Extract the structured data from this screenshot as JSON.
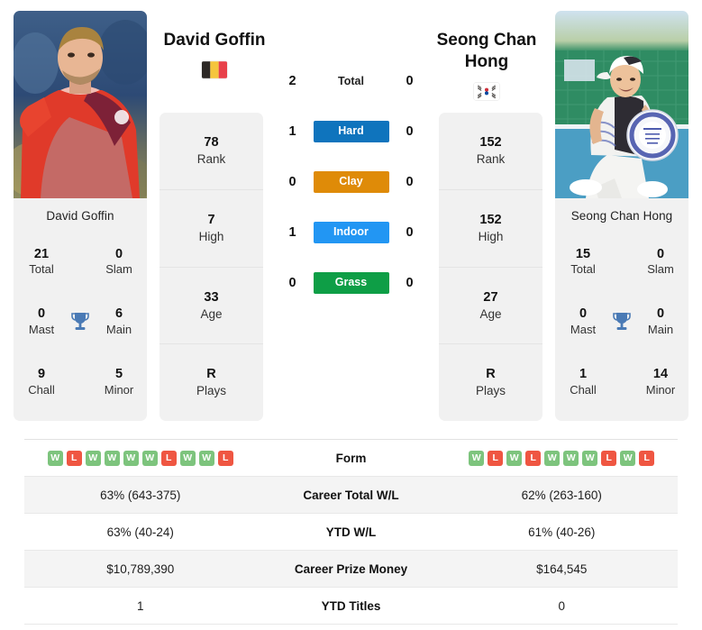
{
  "players": {
    "left": {
      "name": "David Goffin",
      "photo_caption": "David Goffin",
      "country": "Belgium",
      "flag_icon": "flag-belgium-icon",
      "stats": [
        {
          "value": "78",
          "label": "Rank"
        },
        {
          "value": "7",
          "label": "High"
        },
        {
          "value": "33",
          "label": "Age"
        },
        {
          "value": "R",
          "label": "Plays"
        }
      ],
      "titles": [
        {
          "value": "21",
          "label": "Total"
        },
        {
          "value": "0",
          "label": "Slam"
        },
        {
          "value": "0",
          "label": "Mast"
        },
        {
          "value": "6",
          "label": "Main"
        },
        {
          "value": "9",
          "label": "Chall"
        },
        {
          "value": "5",
          "label": "Minor"
        }
      ],
      "form": [
        "W",
        "L",
        "W",
        "W",
        "W",
        "W",
        "L",
        "W",
        "W",
        "L"
      ],
      "career_total_wl": "63% (643-375)",
      "ytd_wl": "63% (40-24)",
      "career_prize_money": "$10,789,390",
      "ytd_titles": "1"
    },
    "right": {
      "name": "Seong Chan Hong",
      "photo_caption": "Seong Chan Hong",
      "country": "South Korea",
      "flag_icon": "flag-south-korea-icon",
      "stats": [
        {
          "value": "152",
          "label": "Rank"
        },
        {
          "value": "152",
          "label": "High"
        },
        {
          "value": "27",
          "label": "Age"
        },
        {
          "value": "R",
          "label": "Plays"
        }
      ],
      "titles": [
        {
          "value": "15",
          "label": "Total"
        },
        {
          "value": "0",
          "label": "Slam"
        },
        {
          "value": "0",
          "label": "Mast"
        },
        {
          "value": "0",
          "label": "Main"
        },
        {
          "value": "1",
          "label": "Chall"
        },
        {
          "value": "14",
          "label": "Minor"
        }
      ],
      "form": [
        "W",
        "L",
        "W",
        "L",
        "W",
        "W",
        "W",
        "L",
        "W",
        "L"
      ],
      "career_total_wl": "62% (263-160)",
      "ytd_wl": "61% (40-26)",
      "career_prize_money": "$164,545",
      "ytd_titles": "0"
    }
  },
  "head_to_head": [
    {
      "label": "Total",
      "left": "2",
      "right": "0",
      "type": "total",
      "color": ""
    },
    {
      "label": "Hard",
      "left": "1",
      "right": "0",
      "type": "badge",
      "color": "#0f74bd"
    },
    {
      "label": "Clay",
      "left": "0",
      "right": "0",
      "type": "badge",
      "color": "#df8b08"
    },
    {
      "label": "Indoor",
      "left": "1",
      "right": "0",
      "type": "badge",
      "color": "#2296f3"
    },
    {
      "label": "Grass",
      "left": "0",
      "right": "0",
      "type": "badge",
      "color": "#0e9e46"
    }
  ],
  "table_rows": [
    {
      "label": "Form",
      "type": "form",
      "left": "",
      "right": ""
    },
    {
      "label": "Career Total W/L",
      "type": "text",
      "left": "63% (643-375)",
      "right": "62% (263-160)"
    },
    {
      "label": "YTD W/L",
      "type": "text",
      "left": "63% (40-24)",
      "right": "61% (40-26)"
    },
    {
      "label": "Career Prize Money",
      "type": "text",
      "left": "$10,789,390",
      "right": "$164,545"
    },
    {
      "label": "YTD Titles",
      "type": "text",
      "left": "1",
      "right": "0"
    }
  ],
  "icons": {
    "trophy": "trophy-icon"
  },
  "colors": {
    "win": "#7dc47d",
    "loss": "#ef5642",
    "hard": "#0f74bd",
    "clay": "#df8b08",
    "indoor": "#2296f3",
    "grass": "#0e9e46",
    "trophy": "#4a7ab5",
    "card_bg": "#f1f1f1"
  }
}
